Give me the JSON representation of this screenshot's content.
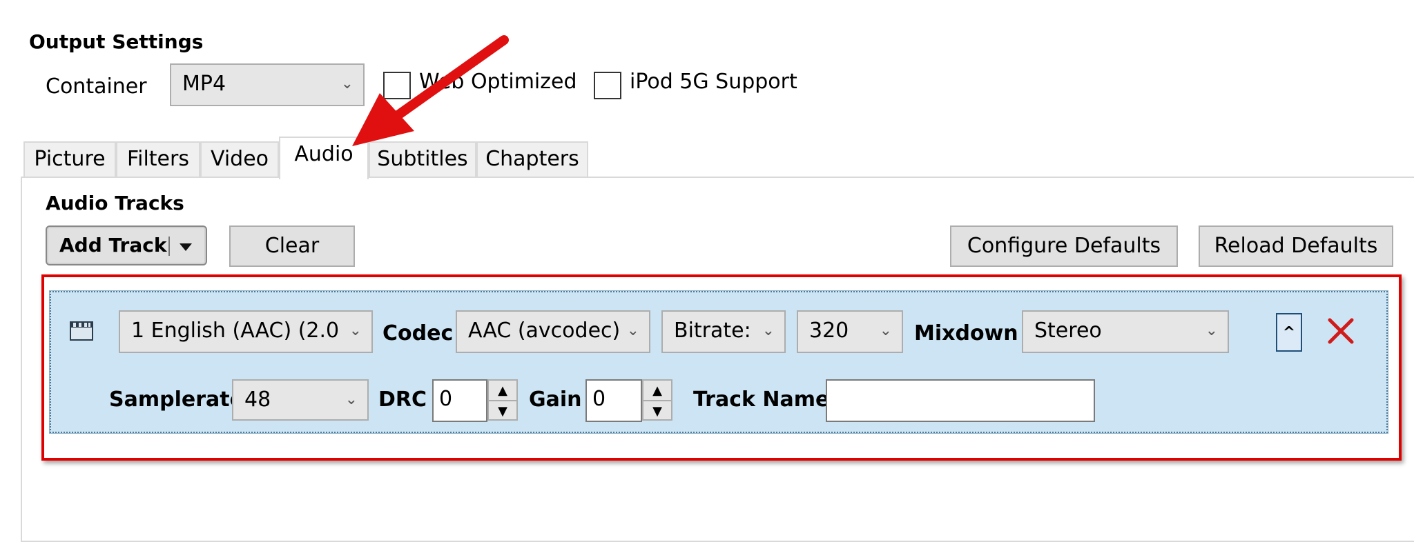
{
  "output": {
    "heading": "Output Settings",
    "container_label": "Container",
    "container_value": "MP4",
    "web_optimized_label": "Web Optimized",
    "ipod_label": "iPod 5G Support"
  },
  "tabs": [
    "Picture",
    "Filters",
    "Video",
    "Audio",
    "Subtitles",
    "Chapters"
  ],
  "audio": {
    "heading": "Audio Tracks",
    "add_track": "Add Track",
    "clear": "Clear",
    "configure_defaults": "Configure Defaults",
    "reload_defaults": "Reload Defaults"
  },
  "track": {
    "source": "1 English (AAC) (2.0",
    "codec_label": "Codec",
    "codec_value": "AAC (avcodec)",
    "bitrate_mode": "Bitrate:",
    "bitrate_value": "320",
    "mixdown_label": "Mixdown",
    "mixdown_value": "Stereo",
    "samplerate_label": "Samplerate",
    "samplerate_value": "48",
    "drc_label": "DRC",
    "drc_value": "0",
    "gain_label": "Gain",
    "gain_value": "0",
    "track_name_label": "Track Name:",
    "track_name_value": "",
    "collapse_glyph": "^"
  },
  "icons": {
    "dropdown": "chevron-down-icon",
    "split_dropdown": "triangle-down-icon",
    "film": "film-clapper-icon",
    "remove": "red-x-icon",
    "annotation": "red-arrow-icon"
  },
  "colors": {
    "highlight_box": "#e00000",
    "track_bg": "#cce4f3",
    "arrow": "#e01010"
  }
}
